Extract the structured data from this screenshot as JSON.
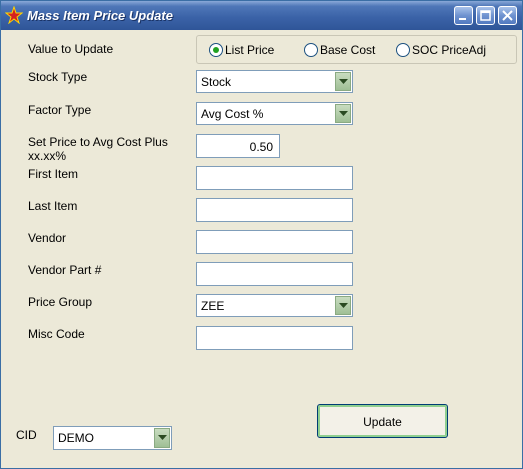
{
  "window": {
    "title": "Mass Item Price Update"
  },
  "form": {
    "value_to_update_label": "Value to Update",
    "radio_options": [
      {
        "label": "List Price",
        "selected": true
      },
      {
        "label": "Base Cost",
        "selected": false
      },
      {
        "label": "SOC PriceAdj",
        "selected": false
      }
    ],
    "stock_type_label": "Stock Type",
    "stock_type_value": "Stock",
    "factor_type_label": "Factor Type",
    "factor_type_value": "Avg Cost %",
    "set_price_label_line1": "Set Price to Avg Cost Plus",
    "set_price_label_line2": "xx.xx%",
    "set_price_value": "0.50",
    "first_item_label": "First Item",
    "first_item_value": "",
    "last_item_label": "Last Item",
    "last_item_value": "",
    "vendor_label": "Vendor",
    "vendor_value": "",
    "vendor_part_label": "Vendor Part #",
    "vendor_part_value": "",
    "price_group_label": "Price Group",
    "price_group_value": "ZEE",
    "misc_code_label": "Misc Code",
    "misc_code_value": "",
    "update_button_label": "Update",
    "cid_label": "CID",
    "cid_value": "DEMO"
  },
  "colors": {
    "titlebar": "#2f5598",
    "window_bg": "#ECE9D8",
    "radio_selected": "#21a121"
  }
}
